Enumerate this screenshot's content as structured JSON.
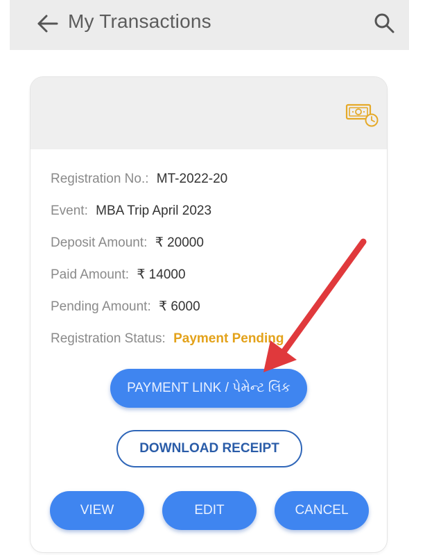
{
  "header": {
    "title": "My Transactions",
    "back_icon": "arrow-left-icon",
    "search_icon": "search-icon"
  },
  "card": {
    "header_icon": "money-clock-icon",
    "fields": [
      {
        "label": "Registration No.:",
        "value": "MT-2022-20"
      },
      {
        "label": "Event:",
        "value": "MBA Trip April 2023"
      },
      {
        "label": "Deposit Amount:",
        "value": "₹ 20000"
      },
      {
        "label": "Paid Amount:",
        "value": "₹ 14000"
      },
      {
        "label": "Pending Amount:",
        "value": "₹ 6000"
      },
      {
        "label": "Registration Status:",
        "value": "Payment Pending"
      }
    ],
    "buttons": {
      "payment_link": "PAYMENT LINK / પેમેન્ટ લિંક",
      "download_receipt": "DOWNLOAD RECEIPT",
      "view": "VIEW",
      "edit": "EDIT",
      "cancel": "CANCEL"
    }
  },
  "colors": {
    "primary_button": "#3f85f0",
    "status": "#e3a21a",
    "annotation_arrow": "#e0393c",
    "app_bar": "#ececec"
  },
  "annotation": {
    "icon": "red-arrow-annotation"
  }
}
